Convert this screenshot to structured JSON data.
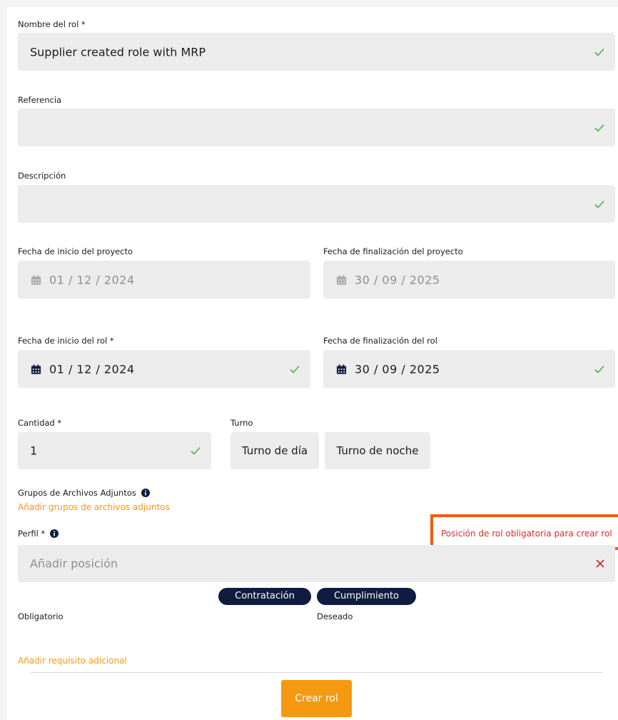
{
  "form": {
    "role_name": {
      "label": "Nombre del rol *",
      "value": "Supplier created role with MRP"
    },
    "reference": {
      "label": "Referencia",
      "value": ""
    },
    "description": {
      "label": "Descripción",
      "value": ""
    },
    "project_start": {
      "label": "Fecha de inicio del proyecto",
      "value": "01 / 12 / 2024"
    },
    "project_end": {
      "label": "Fecha de finalización del proyecto",
      "value": "30 / 09 / 2025"
    },
    "role_start": {
      "label": "Fecha de inicio del rol *",
      "value": "01 / 12 / 2024"
    },
    "role_end": {
      "label": "Fecha de finalización del rol",
      "value": "30 / 09 / 2025"
    },
    "quantity": {
      "label": "Cantidad *",
      "value": "1"
    },
    "shift": {
      "label": "Turno",
      "options": [
        "Turno de día",
        "Turno de noche"
      ]
    },
    "attachments": {
      "label": "Grupos de Archivos Adjuntos",
      "link": "Añadir grupos de archivos adjuntos"
    },
    "profile": {
      "label": "Perfil *",
      "placeholder": "Añadir posición",
      "error": "Posición de rol obligatoria para crear rol"
    },
    "requirements": {
      "tags": [
        "Contratación",
        "Cumplimiento"
      ],
      "mandatory_label": "Obligatorio",
      "desired_label": "Deseado",
      "add_link": "Añadir requisito adicional"
    },
    "submit_label": "Crear rol"
  },
  "icons": {
    "check": "check-icon",
    "calendar": "calendar-icon",
    "info": "info-icon",
    "error": "close-icon"
  },
  "colors": {
    "accent": "#f59a10",
    "success": "#4caf50",
    "error": "#d62e2e",
    "highlight_border": "#f25c10",
    "pill_bg": "#0f1c3f",
    "field_bg": "#ececec"
  }
}
